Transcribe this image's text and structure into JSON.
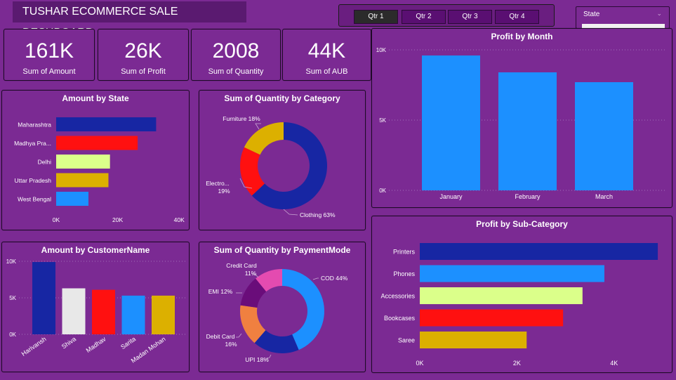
{
  "header": {
    "title": "TUSHAR ECOMMERCE SALE DESHBOARD",
    "quarters": [
      "Qtr 1",
      "Qtr 2",
      "Qtr 3",
      "Qtr 4"
    ],
    "active_quarter": "Qtr 1",
    "state_slicer_label": "State"
  },
  "kpis": [
    {
      "value": "161K",
      "label": "Sum of Amount"
    },
    {
      "value": "26K",
      "label": "Sum of Profit"
    },
    {
      "value": "2008",
      "label": "Sum of Quantity"
    },
    {
      "value": "44K",
      "label": "Sum of AUB"
    }
  ],
  "colors": {
    "background": "#7b2a93",
    "navy": "#1726a3",
    "blue": "#1c90ff",
    "red": "#ff1010",
    "lime": "#dbff8a",
    "gold": "#dcb000",
    "white": "#e8e8e8",
    "pink": "#e44bb0",
    "orange": "#f08040",
    "purple": "#6a0d7a"
  },
  "chart_data": [
    {
      "id": "amount_by_state",
      "type": "bar",
      "orientation": "horizontal",
      "title": "Amount by State",
      "categories": [
        "Maharashtra",
        "Madhya Pra...",
        "Delhi",
        "Uttar Pradesh",
        "West Bengal"
      ],
      "values": [
        32500,
        26500,
        17500,
        17000,
        10500
      ],
      "colors": [
        "#1726a3",
        "#ff1010",
        "#dbff8a",
        "#dcb000",
        "#1c90ff"
      ],
      "xlim": [
        0,
        42000
      ],
      "ticks": [
        {
          "v": 0,
          "label": "0K"
        },
        {
          "v": 20000,
          "label": "20K"
        },
        {
          "v": 40000,
          "label": "40K"
        }
      ]
    },
    {
      "id": "qty_by_category",
      "type": "pie",
      "donut": true,
      "title": "Sum of Quantity by Category",
      "slices": [
        {
          "label": "Clothing 63%",
          "value": 63,
          "color": "#1726a3"
        },
        {
          "label": "Electro... 19%",
          "value": 19,
          "color": "#ff1010"
        },
        {
          "label": "Furniture 18%",
          "value": 18,
          "color": "#dcb000"
        }
      ]
    },
    {
      "id": "profit_by_month",
      "type": "bar",
      "title": "Profit by Month",
      "categories": [
        "January",
        "February",
        "March"
      ],
      "values": [
        9600,
        8400,
        7700
      ],
      "color": "#1c90ff",
      "ylim": [
        0,
        10000
      ],
      "ticks": [
        {
          "v": 0,
          "label": "0K"
        },
        {
          "v": 5000,
          "label": "5K"
        },
        {
          "v": 10000,
          "label": "10K"
        }
      ]
    },
    {
      "id": "amount_by_customer",
      "type": "bar",
      "title": "Amount by CustomerName",
      "categories": [
        "Harivansh",
        "Shiva",
        "Madhav",
        "Sarita",
        "Madan Mohan"
      ],
      "values": [
        9900,
        6300,
        6100,
        5300,
        5300
      ],
      "colors": [
        "#1726a3",
        "#e8e8e8",
        "#ff1010",
        "#1c90ff",
        "#dcb000"
      ],
      "ylim": [
        0,
        10000
      ],
      "ticks": [
        {
          "v": 0,
          "label": "0K"
        },
        {
          "v": 5000,
          "label": "5K"
        },
        {
          "v": 10000,
          "label": "10K"
        }
      ]
    },
    {
      "id": "qty_by_paymentmode",
      "type": "pie",
      "donut": true,
      "title": "Sum of Quantity by PaymentMode",
      "slices": [
        {
          "label": "COD 44%",
          "value": 44,
          "color": "#1c90ff"
        },
        {
          "label": "UPI 18%",
          "value": 18,
          "color": "#1726a3"
        },
        {
          "label": "Debit Card 16%",
          "value": 16,
          "color": "#f08040"
        },
        {
          "label": "EMI 12%",
          "value": 12,
          "color": "#6a0d7a"
        },
        {
          "label": "Credit Card 11%",
          "value": 11,
          "color": "#e44bb0"
        }
      ]
    },
    {
      "id": "profit_by_subcategory",
      "type": "bar",
      "orientation": "horizontal",
      "title": "Profit by Sub-Category",
      "categories": [
        "Printers",
        "Phones",
        "Accessories",
        "Bookcases",
        "Saree"
      ],
      "values": [
        4900,
        3800,
        3350,
        2950,
        2200
      ],
      "colors": [
        "#1726a3",
        "#1c90ff",
        "#dbff8a",
        "#ff1010",
        "#dcb000"
      ],
      "xlim": [
        0,
        5000
      ],
      "ticks": [
        {
          "v": 0,
          "label": "0K"
        },
        {
          "v": 2000,
          "label": "2K"
        },
        {
          "v": 4000,
          "label": "4K"
        }
      ]
    }
  ]
}
